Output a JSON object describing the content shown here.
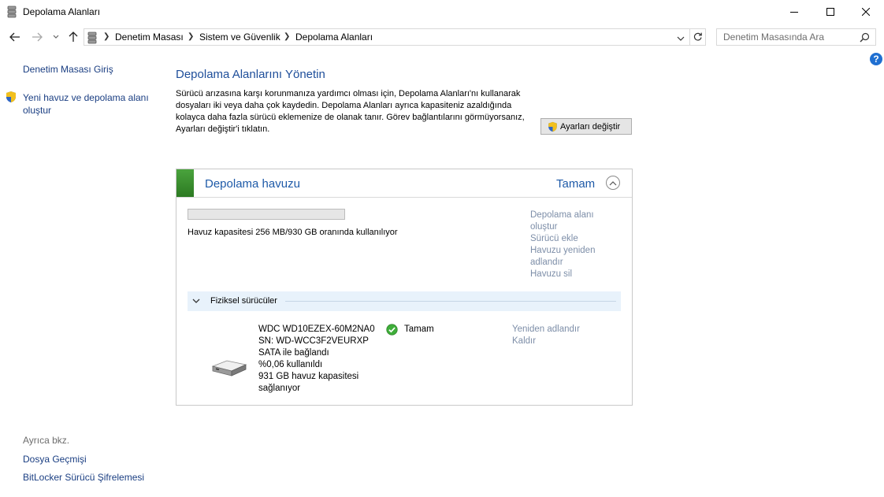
{
  "window": {
    "title": "Depolama Alanları"
  },
  "address": {
    "breadcrumbs": [
      "Denetim Masası",
      "Sistem ve Güvenlik",
      "Depolama Alanları"
    ],
    "search_placeholder": "Denetim Masasında Ara"
  },
  "left_pane": {
    "home": "Denetim Masası Giriş",
    "create_pool": "Yeni havuz ve depolama alanı oluştur",
    "see_also": "Ayrıca bkz.",
    "file_history": "Dosya Geçmişi",
    "bitlocker": "BitLocker Sürücü Şifrelemesi"
  },
  "main": {
    "title": "Depolama Alanlarını Yönetin",
    "description": "Sürücü arızasına karşı korunmanıza yardımcı olması için, Depolama Alanları'nı kullanarak dosyaları iki veya daha çok kaydedin. Depolama Alanları ayrıca kapasiteniz azaldığında kolayca daha fazla sürücü eklemenize de olanak tanır. Görev bağlantılarını görmüyorsanız, Ayarları değiştir'i tıklatın.",
    "change_settings": "Ayarları değiştir"
  },
  "pool": {
    "name": "Depolama havuzu",
    "status": "Tamam",
    "usage_fraction": 0.0003,
    "usage_text": "Havuz kapasitesi 256 MB/930 GB oranında kullanılıyor",
    "actions": {
      "create_space": "Depolama alanı oluştur",
      "add_drive": "Sürücü ekle",
      "rename_pool": "Havuzu yeniden adlandır",
      "delete_pool": "Havuzu sil"
    },
    "physical_drives_title": "Fiziksel sürücüler",
    "drive": {
      "model": "WDC WD10EZEX-60M2NA0",
      "serial": "SN: WD-WCC3F2VEURXP",
      "connection": "SATA ile bağlandı",
      "used": "%0,06 kullanıldı",
      "capacity": "931 GB havuz kapasitesi sağlanıyor",
      "status": "Tamam",
      "rename": "Yeniden adlandır",
      "remove": "Kaldır"
    }
  },
  "colors": {
    "link": "#1a3e82",
    "heading": "#1e4e9a",
    "muted_link": "#7d8ea8",
    "accent_green": "#2c7a22"
  }
}
